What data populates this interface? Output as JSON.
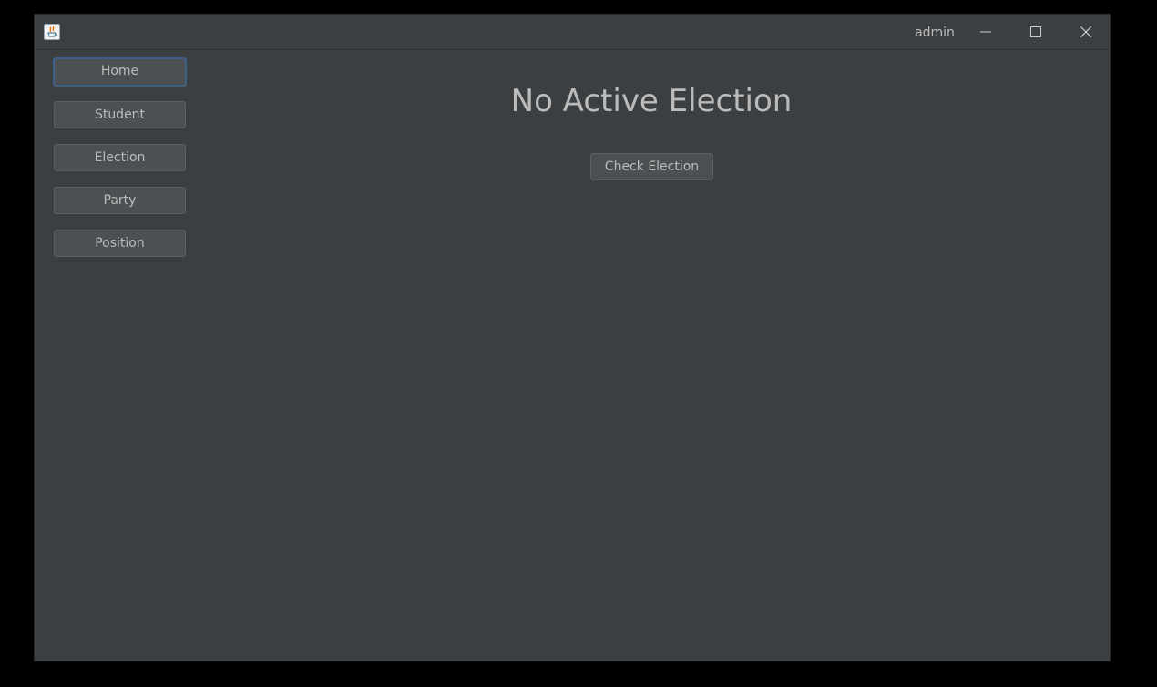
{
  "titlebar": {
    "user": "admin",
    "icons": {
      "app": "java-app-icon",
      "minimize": "minimize-icon",
      "maximize": "maximize-icon",
      "close": "close-icon"
    }
  },
  "sidebar": {
    "items": [
      {
        "label": "Home",
        "focused": true
      },
      {
        "label": "Student"
      },
      {
        "label": "Election"
      },
      {
        "label": "Party"
      },
      {
        "label": "Position"
      }
    ]
  },
  "main": {
    "title": "No Active Election",
    "check_button": "Check Election"
  },
  "colors": {
    "window_bg": "#3c3f41",
    "button_bg": "#4c5052",
    "text": "#bbbbbb",
    "focus_border": "#3d6185"
  }
}
